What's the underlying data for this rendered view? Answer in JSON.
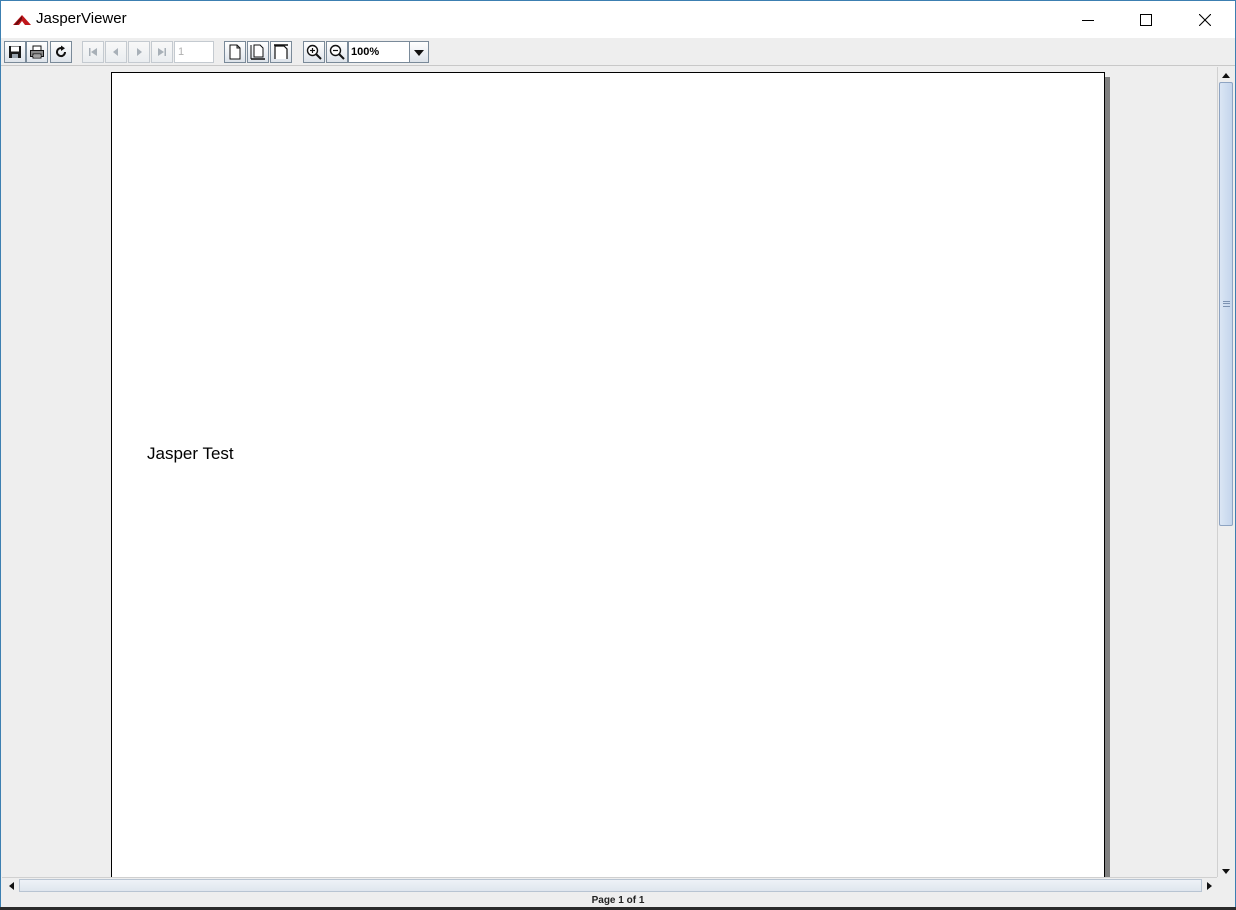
{
  "window": {
    "title": "JasperViewer",
    "minimize_icon": "minimize-icon",
    "maximize_icon": "maximize-icon",
    "close_icon": "close-icon"
  },
  "toolbar": {
    "buttons": [
      {
        "name": "save",
        "icon": "save-icon",
        "enabled": true
      },
      {
        "name": "print",
        "icon": "print-icon",
        "enabled": true
      },
      {
        "name": "reload",
        "icon": "reload-icon",
        "enabled": true
      },
      {
        "name": "first-page",
        "icon": "first-page-icon",
        "enabled": false
      },
      {
        "name": "previous-page",
        "icon": "previous-page-icon",
        "enabled": false
      },
      {
        "name": "next-page",
        "icon": "next-page-icon",
        "enabled": false
      },
      {
        "name": "last-page",
        "icon": "last-page-icon",
        "enabled": false
      },
      {
        "name": "actual-size",
        "icon": "actual-size-icon",
        "enabled": true
      },
      {
        "name": "fit-page",
        "icon": "fit-page-icon",
        "enabled": true
      },
      {
        "name": "fit-width",
        "icon": "fit-width-icon",
        "enabled": true
      },
      {
        "name": "zoom-in",
        "icon": "zoom-in-icon",
        "enabled": true
      },
      {
        "name": "zoom-out",
        "icon": "zoom-out-icon",
        "enabled": true
      }
    ],
    "page_number": "1",
    "zoom_value": "100%"
  },
  "report": {
    "text": "Jasper Test"
  },
  "status": {
    "page_info": "Page 1 of 1"
  },
  "colors": {
    "window_border": "#3c7fb1",
    "app_icon_red": "#c0161b",
    "background": "#eeeeee"
  }
}
